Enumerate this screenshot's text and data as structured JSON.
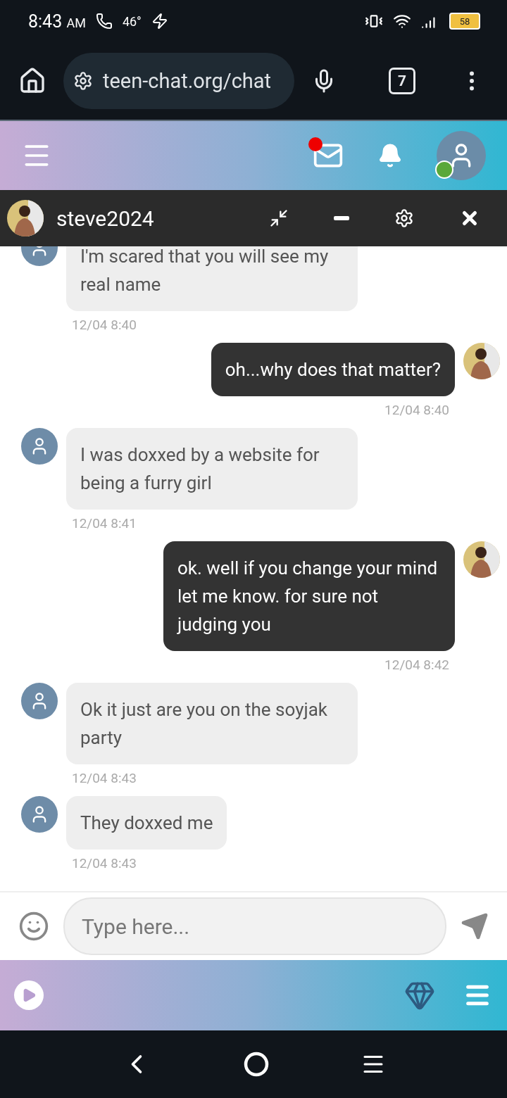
{
  "status_bar": {
    "time": "8:43",
    "ampm": "AM",
    "temperature": "46°",
    "battery": "58"
  },
  "browser": {
    "url": "teen-chat.org/chat",
    "tab_count": "7"
  },
  "header": {
    "mail_unread": true,
    "online": true
  },
  "chat_header": {
    "username": "steve2024"
  },
  "messages": [
    {
      "kind": "incoming",
      "text": "I'm scared that you will see my real name",
      "time": "12/04 8:40"
    },
    {
      "kind": "outgoing",
      "text": "oh...why does that matter?",
      "time": "12/04 8:40"
    },
    {
      "kind": "incoming",
      "text": "I was doxxed by a website for being a furry girl",
      "time": "12/04 8:41"
    },
    {
      "kind": "outgoing",
      "text": "ok. well if you change your mind let me know. for sure not judging you",
      "time": "12/04 8:42"
    },
    {
      "kind": "incoming",
      "text": "Ok it just are you on the soyjak party",
      "time": "12/04 8:43"
    },
    {
      "kind": "incoming",
      "text": "They doxxed me",
      "time": "12/04 8:43"
    }
  ],
  "composer": {
    "placeholder": "Type here..."
  }
}
